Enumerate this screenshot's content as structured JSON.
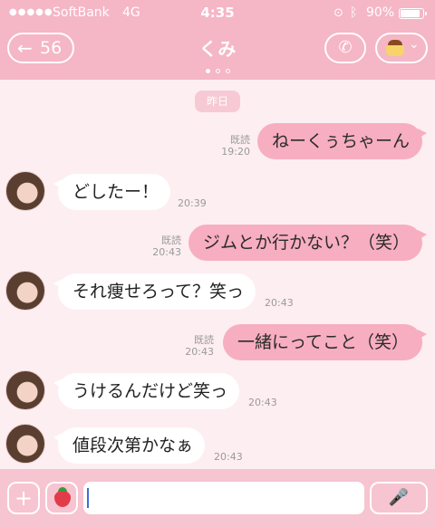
{
  "status": {
    "signal": "●●●●●",
    "carrier": "SoftBank",
    "network": "4G",
    "time": "4:35",
    "battery_label": "90%",
    "battery_level": 0.9,
    "lock_icon": "lock-rotation-icon",
    "bluetooth_icon": "bluetooth-icon"
  },
  "header": {
    "back_arrow": "←",
    "unread_count": "56",
    "title": "くみ",
    "call_glyph": "✆",
    "menu_chevron": "⌄"
  },
  "chat": {
    "date_label": "昨日",
    "messages": [
      {
        "side": "me",
        "text": "ねーくぅちゃーん",
        "read": "既読",
        "time": "19:20"
      },
      {
        "side": "them",
        "text": "どしたー！",
        "time": "20:39"
      },
      {
        "side": "me",
        "text": "ジムとか行かない？（笑）",
        "read": "既読",
        "time": "20:43"
      },
      {
        "side": "them",
        "text": "それ痩せろって？笑っ",
        "time": "20:43"
      },
      {
        "side": "me",
        "text": "一緒にってこと（笑）",
        "read": "既読",
        "time": "20:43"
      },
      {
        "side": "them",
        "text": "うけるんだけど笑っ",
        "time": "20:43"
      },
      {
        "side": "them",
        "text": "値段次第かなぁ",
        "time": "20:43"
      }
    ]
  },
  "input": {
    "plus_glyph": "+",
    "value": "",
    "mic_glyph": "🎤"
  },
  "colors": {
    "header_pink": "#f5b6c6",
    "my_bubble": "#f7aec0",
    "background": "#fdeef2"
  }
}
